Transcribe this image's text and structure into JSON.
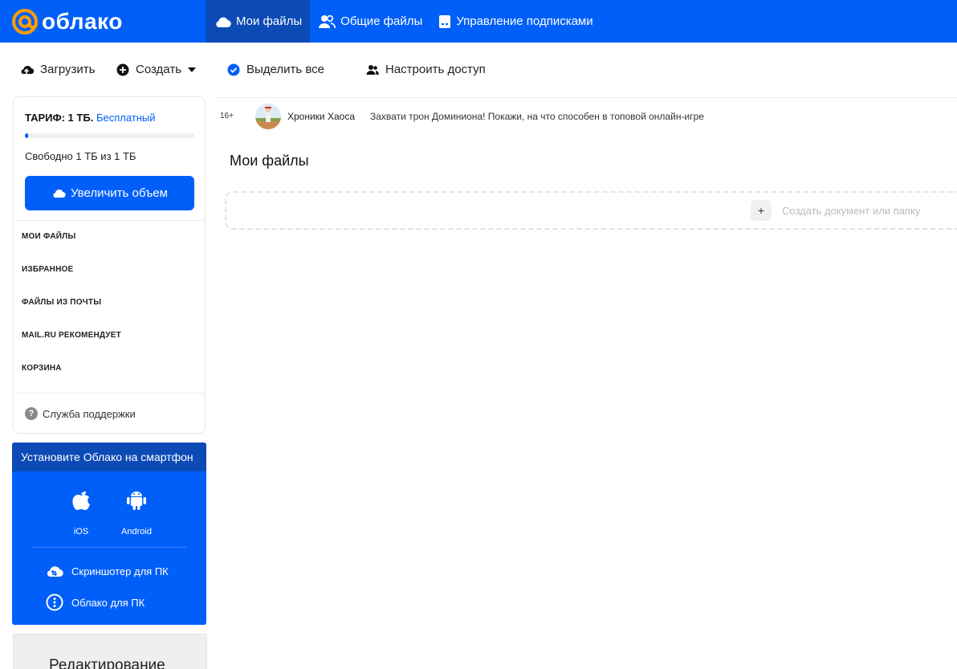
{
  "header": {
    "logo_text": "облако",
    "nav": [
      {
        "label": "Мои файлы",
        "icon": "cloud-icon",
        "active": true
      },
      {
        "label": "Общие файлы",
        "icon": "people-icon",
        "active": false
      },
      {
        "label": "Управление подписками",
        "icon": "subscription-icon",
        "active": false
      }
    ],
    "accent_color": "#005ff9",
    "active_nav_color": "#0c4ab6"
  },
  "toolbar": {
    "upload_label": "Загрузить",
    "create_label": "Создать",
    "select_all_label": "Выделить все",
    "access_label": "Настроить доступ"
  },
  "sidebar": {
    "tariff_label": "ТАРИФ: 1 ТБ.",
    "tariff_plan": "Бесплатный",
    "quota_used_fraction": 0.01,
    "free_text": "Свободно 1 ТБ из 1 ТБ",
    "upgrade_label": "Увеличить объем",
    "nav": [
      {
        "label": "МОИ ФАЙЛЫ"
      },
      {
        "label": "ИЗБРАННОЕ"
      },
      {
        "label": "ФАЙЛЫ ИЗ ПОЧТЫ"
      },
      {
        "label": "MAIL.RU РЕКОМЕНДУЕТ"
      },
      {
        "label": "КОРЗИНА"
      }
    ],
    "support_label": "Служба поддержки"
  },
  "app_promo": {
    "title": "Установите Облако на смартфон",
    "ios_label": "iOS",
    "android_label": "Android",
    "screenshoter_label": "Скриншотер для ПК",
    "desktop_label": "Облако для ПК"
  },
  "edit_card": {
    "title": "Редактирование"
  },
  "ad": {
    "age_rating": "16+",
    "name": "Хроники Хаоса",
    "text": "Захвати трон Доминиона! Покажи, на что способен в топовой онлайн-игре"
  },
  "main": {
    "title": "Мои файлы",
    "create_prompt": "Создать документ или папку",
    "plus_symbol": "+"
  }
}
